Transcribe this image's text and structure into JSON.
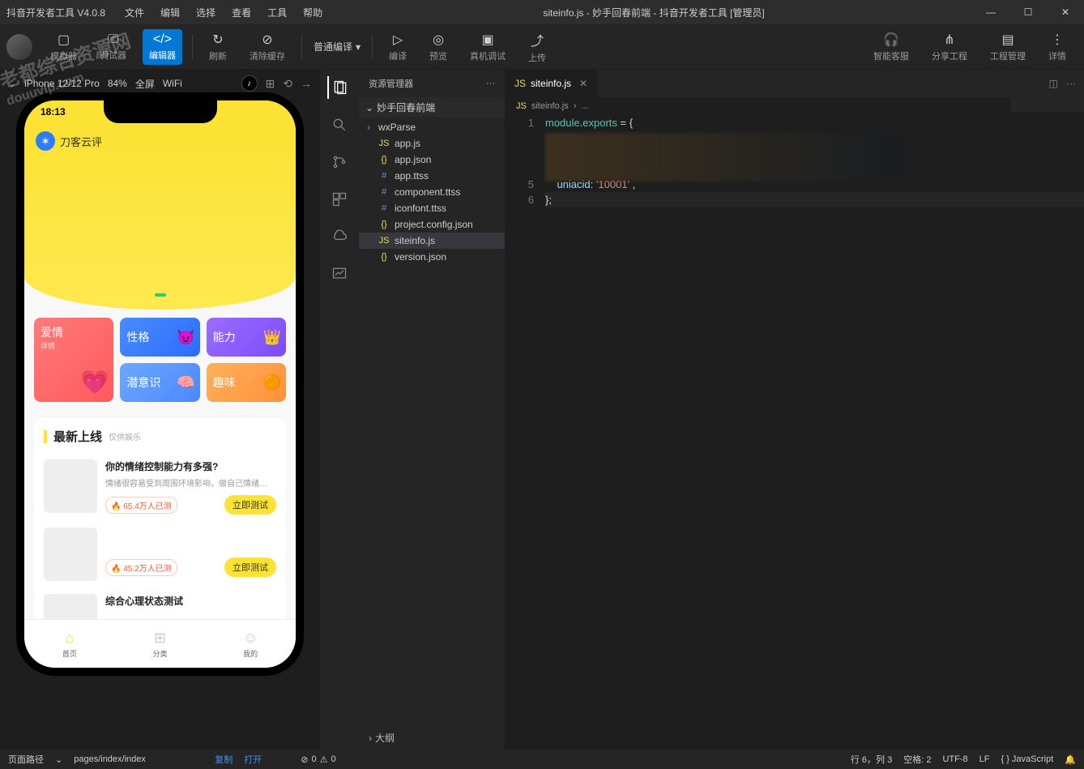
{
  "titlebar": {
    "app_name": "抖音开发者工具 V4.0.8",
    "menus": [
      "文件",
      "编辑",
      "选择",
      "查看",
      "工具",
      "帮助"
    ],
    "window_title": "siteinfo.js - 妙手回春前端 - 抖音开发者工具 [管理员]"
  },
  "toolbar": {
    "items": [
      {
        "label": "模拟器",
        "icon": "▢"
      },
      {
        "label": "调试器",
        "icon": "⎚"
      },
      {
        "label": "编辑器",
        "icon": "</>",
        "active": true
      },
      {
        "label": "刷新",
        "icon": "↻"
      },
      {
        "label": "清除缓存",
        "icon": "⊘"
      }
    ],
    "compile_dropdown": "普通编译",
    "mid": [
      {
        "label": "编译",
        "icon": "▷"
      },
      {
        "label": "预览",
        "icon": "◎"
      },
      {
        "label": "真机调试",
        "icon": "▣"
      },
      {
        "label": "上传",
        "icon": "⤴"
      }
    ],
    "right": [
      {
        "label": "智能客服",
        "icon": "🎧"
      },
      {
        "label": "分享工程",
        "icon": "⋔"
      },
      {
        "label": "工程管理",
        "icon": "▤"
      },
      {
        "label": "详情",
        "icon": "⋮"
      }
    ]
  },
  "simulator": {
    "device": "iPhone 12/12 Pro",
    "zoom": "84%",
    "screen_mode": "全屏",
    "network": "WiFi",
    "status_time": "18:13",
    "brand": "刀客云评",
    "cards": {
      "love": "爱情",
      "personality": "性格",
      "ability": "能力",
      "subconscious": "潜意识",
      "fun": "趣味",
      "sub": "详情"
    },
    "section_title": "最新上线",
    "section_sub": "仅供娱乐",
    "item1": {
      "title": "你的情绪控制能力有多强?",
      "desc": "情绪很容易受到周围环境影响，做自己情绪…",
      "badge": "🔥 65.4万人已测",
      "cta": "立即测试"
    },
    "item2": {
      "badge": "🔥 45.2万人已测",
      "cta": "立即测试"
    },
    "item3": {
      "title": "综合心理状态测试"
    },
    "tabs": [
      "首页",
      "分类",
      "我的"
    ]
  },
  "explorer": {
    "title": "资源管理器",
    "root": "妙手回春前端",
    "folder": "wxParse",
    "files": [
      {
        "name": "app.js",
        "type": "js"
      },
      {
        "name": "app.json",
        "type": "json"
      },
      {
        "name": "app.ttss",
        "type": "hash"
      },
      {
        "name": "component.ttss",
        "type": "hash"
      },
      {
        "name": "iconfont.ttss",
        "type": "hash"
      },
      {
        "name": "project.config.json",
        "type": "json"
      },
      {
        "name": "siteinfo.js",
        "type": "js",
        "selected": true
      },
      {
        "name": "version.json",
        "type": "json"
      }
    ],
    "outline": "大纲"
  },
  "editor": {
    "tab_name": "siteinfo.js",
    "breadcrumb": [
      "siteinfo.js",
      "..."
    ],
    "lines": {
      "l1_a": "module",
      "l1_b": ".",
      "l1_c": "exports",
      "l1_d": " = {",
      "l5_a": "    uniacid",
      "l5_b": ": ",
      "l5_c": "'10001'",
      "l5_d": " ,",
      "l6": "};"
    },
    "line_nums": [
      "1",
      "",
      "",
      "",
      "5",
      "6"
    ]
  },
  "statusbar": {
    "page_path_label": "页面路径",
    "page_path": "pages/index/index",
    "copy": "复制",
    "open": "打开",
    "errors": "0",
    "warnings": "0",
    "cursor": "行 6，列 3",
    "spaces": "空格: 2",
    "encoding": "UTF-8",
    "eol": "LF",
    "lang": "{ } JavaScript"
  },
  "watermark": {
    "l1": "老都综合资源网",
    "l2": "douuvip.com"
  }
}
